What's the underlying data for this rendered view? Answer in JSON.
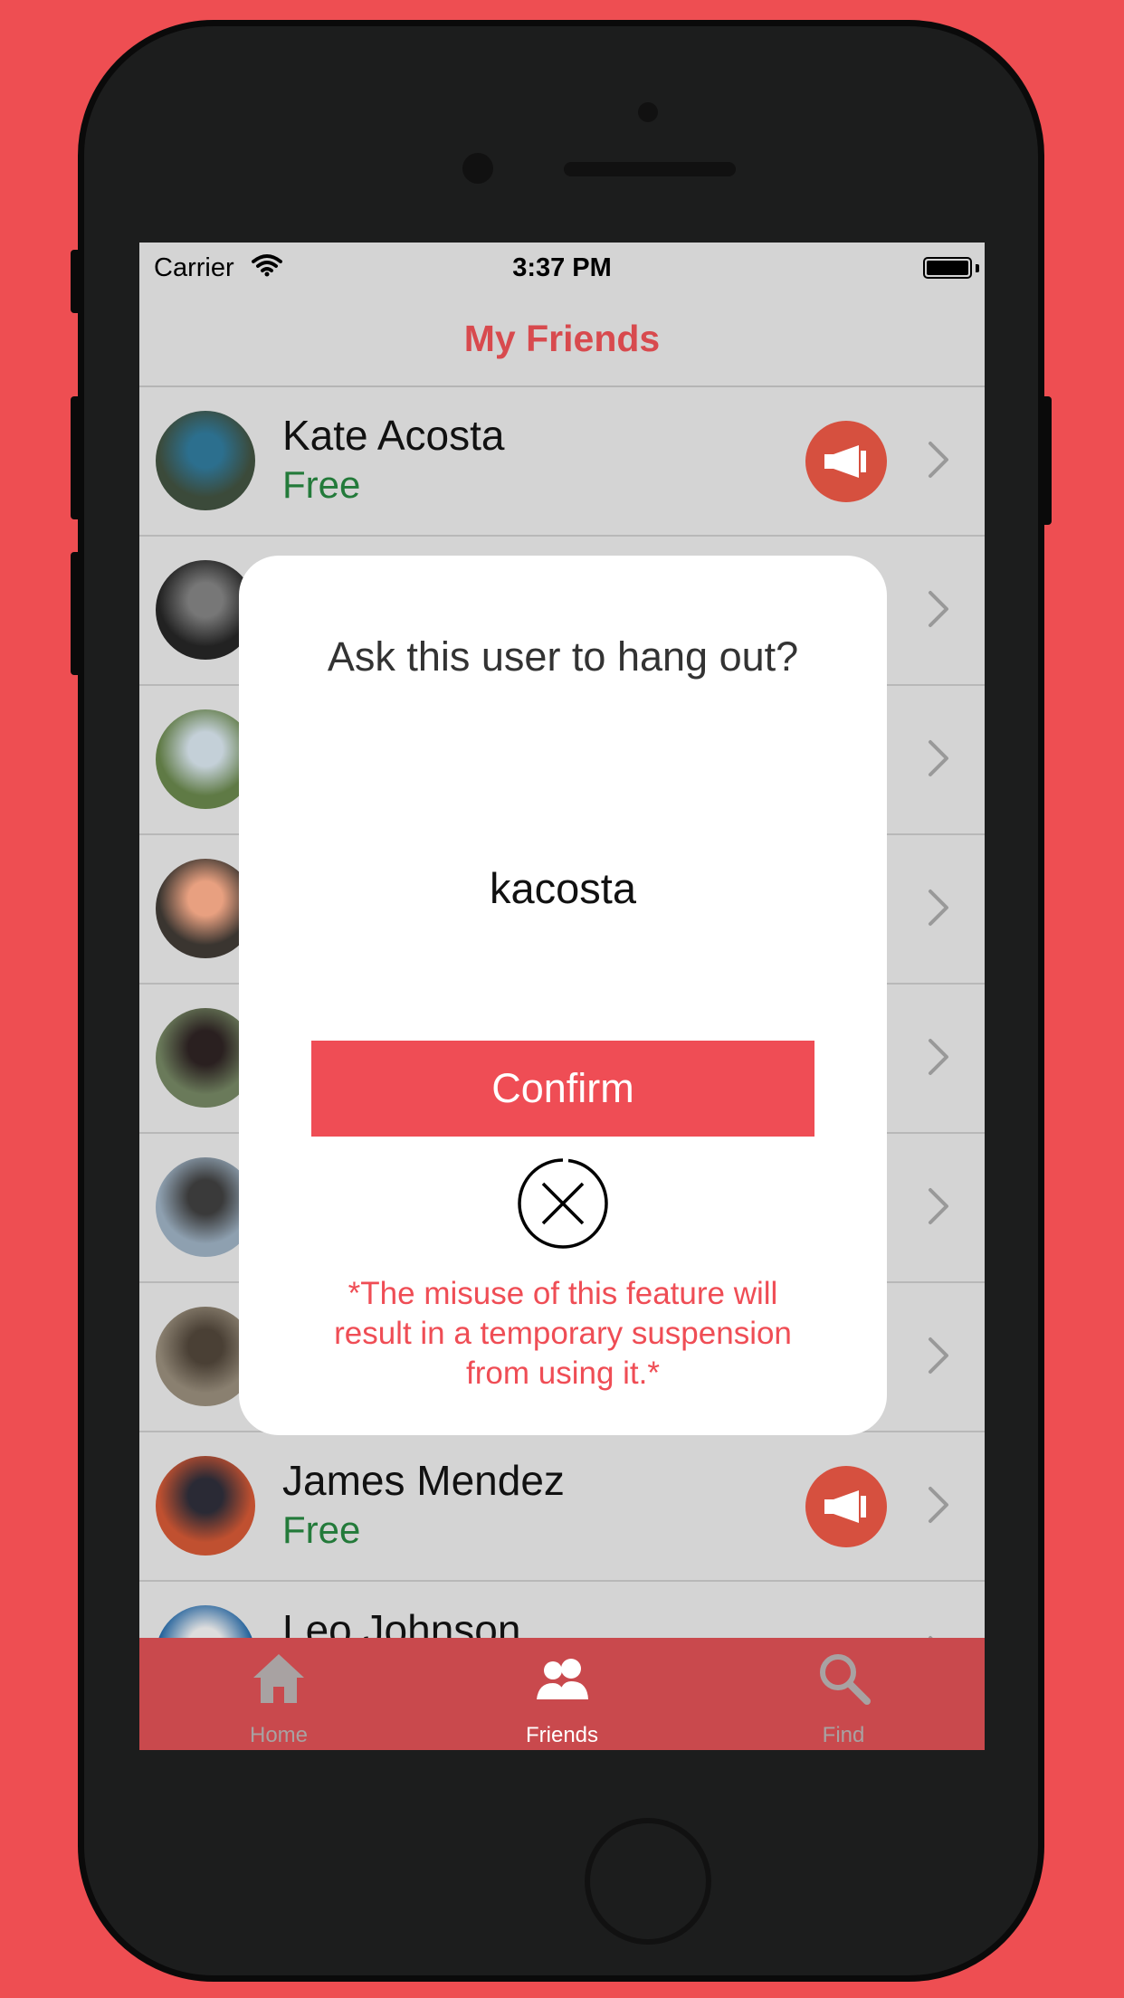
{
  "status_bar": {
    "carrier": "Carrier",
    "time": "3:37 PM",
    "battery_level": 1.0
  },
  "nav": {
    "title": "My Friends"
  },
  "friends": [
    {
      "name": "Kate Acosta",
      "status": "Free",
      "avatar_colors": [
        "#3b4a3a",
        "#2c6f8e"
      ]
    },
    {
      "name": "",
      "status": "",
      "avatar_colors": [
        "#222222",
        "#777777"
      ]
    },
    {
      "name": "",
      "status": "",
      "avatar_colors": [
        "#5f7a45",
        "#c4d0d8"
      ]
    },
    {
      "name": "",
      "status": "",
      "avatar_colors": [
        "#3a3530",
        "#e8a080"
      ]
    },
    {
      "name": "",
      "status": "",
      "avatar_colors": [
        "#6a7a5a",
        "#2a2020"
      ]
    },
    {
      "name": "",
      "status": "",
      "avatar_colors": [
        "#8ea0b0",
        "#3a3a3a"
      ]
    },
    {
      "name": "",
      "status": "",
      "avatar_colors": [
        "#8a8070",
        "#4a4035"
      ]
    },
    {
      "name": "James Mendez",
      "status": "Free",
      "avatar_colors": [
        "#c05030",
        "#2a2a35"
      ]
    },
    {
      "name": "Leo Johnson",
      "status": "",
      "avatar_colors": [
        "#1f5f9a",
        "#dddddd"
      ]
    }
  ],
  "dialog": {
    "title": "Ask this user to hang out?",
    "username": "kacosta",
    "confirm_label": "Confirm",
    "close_icon": "close-circle-icon",
    "warning": "*The misuse of this feature will result in a temporary suspension from using it.*"
  },
  "tabs": [
    {
      "label": "Home",
      "icon": "home-icon",
      "active": false
    },
    {
      "label": "Friends",
      "icon": "friends-icon",
      "active": true
    },
    {
      "label": "Find",
      "icon": "search-icon",
      "active": false
    }
  ],
  "colors": {
    "background": "#ee4e52",
    "accent": "#ef4d55",
    "free_status": "#237a3a",
    "megaphone": "#d6503f",
    "tabbar": "#c9494d"
  }
}
